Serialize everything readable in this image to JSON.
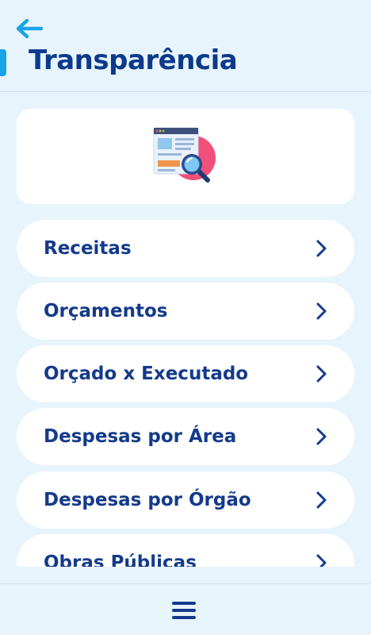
{
  "header": {
    "title": "Transparência",
    "back_icon": "arrow-left-icon",
    "accent_color": "#1aa3e8",
    "title_color": "#0b3a8c"
  },
  "hero": {
    "icon": "document-search-icon"
  },
  "menu": {
    "items": [
      {
        "label": "Receitas",
        "icon": "chevron-right-icon"
      },
      {
        "label": "Orçamentos",
        "icon": "chevron-right-icon"
      },
      {
        "label": "Orçado x Executado",
        "icon": "chevron-right-icon"
      },
      {
        "label": "Despesas por Área",
        "icon": "chevron-right-icon"
      },
      {
        "label": "Despesas por Órgão",
        "icon": "chevron-right-icon"
      },
      {
        "label": "Obras Públicas",
        "icon": "chevron-right-icon"
      }
    ]
  },
  "bottom_bar": {
    "icon": "hamburger-menu-icon"
  },
  "colors": {
    "background": "#e8f4fc",
    "card": "#ffffff",
    "label": "#143a8a"
  }
}
